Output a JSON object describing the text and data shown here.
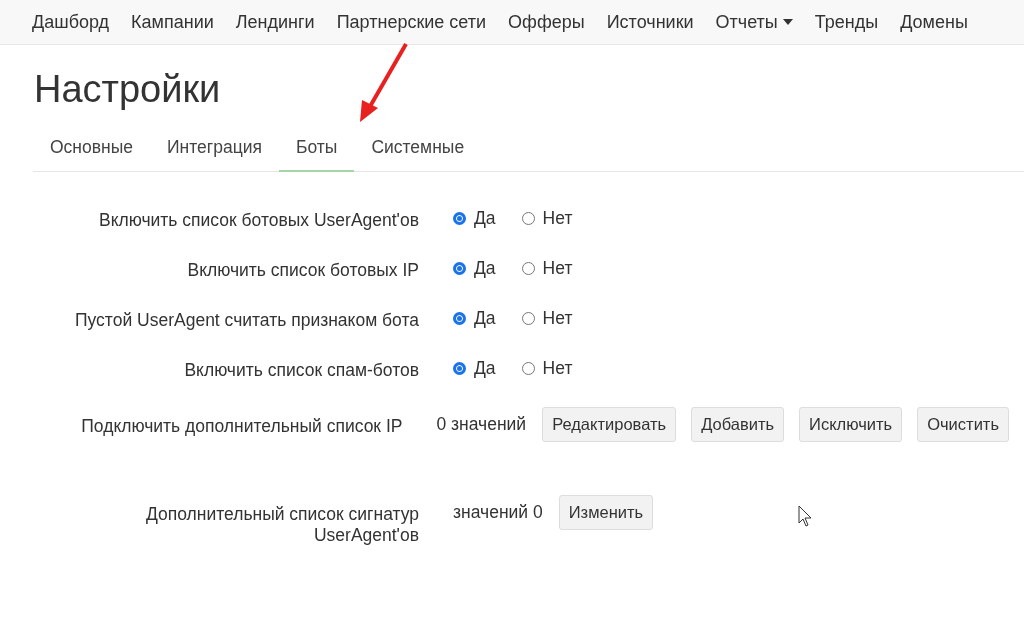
{
  "nav": {
    "items": [
      {
        "label": "Дашборд",
        "dropdown": false
      },
      {
        "label": "Кампании",
        "dropdown": false
      },
      {
        "label": "Лендинги",
        "dropdown": false
      },
      {
        "label": "Партнерские сети",
        "dropdown": false
      },
      {
        "label": "Офферы",
        "dropdown": false
      },
      {
        "label": "Источники",
        "dropdown": false
      },
      {
        "label": "Отчеты",
        "dropdown": true
      },
      {
        "label": "Тренды",
        "dropdown": false
      },
      {
        "label": "Домены",
        "dropdown": false
      }
    ]
  },
  "page_title": "Настройки",
  "tabs": [
    {
      "label": "Основные",
      "selected": false
    },
    {
      "label": "Интеграция",
      "selected": false
    },
    {
      "label": "Боты",
      "selected": true
    },
    {
      "label": "Системные",
      "selected": false
    }
  ],
  "rows": [
    {
      "kind": "radio",
      "label": "Включить список ботовых UserAgent'ов",
      "options": [
        {
          "label": "Да",
          "selected": true
        },
        {
          "label": "Нет",
          "selected": false
        }
      ]
    },
    {
      "kind": "radio",
      "label": "Включить список ботовых IP",
      "options": [
        {
          "label": "Да",
          "selected": true
        },
        {
          "label": "Нет",
          "selected": false
        }
      ]
    },
    {
      "kind": "radio",
      "label": "Пустой UserAgent считать признаком бота",
      "options": [
        {
          "label": "Да",
          "selected": true
        },
        {
          "label": "Нет",
          "selected": false
        }
      ]
    },
    {
      "kind": "radio",
      "label": "Включить список спам-ботов",
      "options": [
        {
          "label": "Да",
          "selected": true
        },
        {
          "label": "Нет",
          "selected": false
        }
      ]
    },
    {
      "kind": "list",
      "label": "Подключить дополнительный список IP",
      "count": "0 значений",
      "buttons": [
        "Редактировать",
        "Добавить",
        "Исключить",
        "Очистить"
      ]
    },
    {
      "kind": "list",
      "label": "Дополнительный список сигнатур UserAgent'ов",
      "count": "значений 0",
      "buttons": [
        "Изменить"
      ]
    }
  ]
}
